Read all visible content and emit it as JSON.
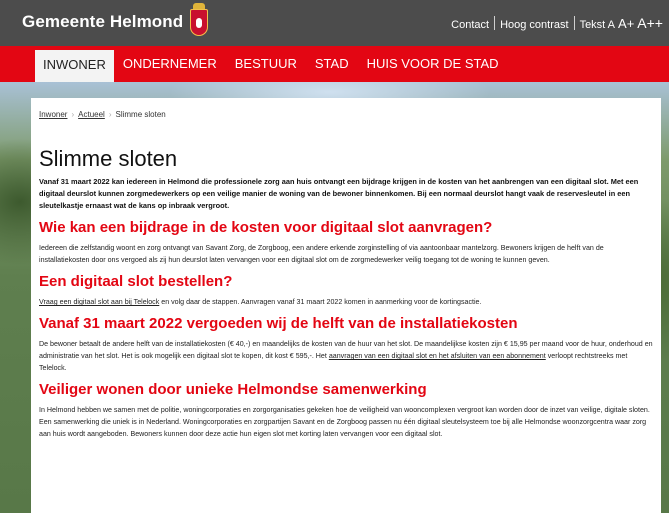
{
  "header": {
    "brand": "Gemeente Helmond",
    "contact": "Contact",
    "high_contrast": "Hoog contrast",
    "text_size_label": "Tekst A",
    "text_size_plus": "A+",
    "text_size_plusplus": "A++",
    "brand_color": "#4c4c4c"
  },
  "nav": {
    "color": "#e30613",
    "tabs": [
      "INWONER",
      "ONDERNEMER",
      "BESTUUR",
      "STAD",
      "HUIS VOOR DE STAD"
    ]
  },
  "breadcrumb": {
    "items": [
      "Inwoner",
      "Actueel"
    ],
    "current": "Slimme sloten"
  },
  "page": {
    "title": "Slimme sloten",
    "lead": "Vanaf 31 maart 2022 kan iedereen in Helmond die professionele zorg aan huis ontvangt een bijdrage krijgen in de kosten van het aanbrengen van een digitaal slot. Met een digitaal deurslot kunnen zorgmedewerkers op een veilige manier de woning van de bewoner binnenkomen. Bij een normaal deurslot hangt vaak de reservesleutel in een sleutelkastje ernaast wat de kans op inbraak vergroot.",
    "sections": [
      {
        "heading": "Wie kan een bijdrage in de kosten voor digitaal slot aanvragen?",
        "text": "Iedereen die zelfstandig woont en zorg ontvangt van Savant Zorg, de Zorgboog, een andere erkende zorginstelling of via aantoonbaar mantelzorg. Bewoners krijgen de helft van de installatiekosten door ons vergoed als zij hun deurslot laten vervangen voor een digitaal slot om de zorgmedewerker veilig toegang tot de woning te kunnen geven."
      },
      {
        "heading": "Een digitaal slot bestellen?",
        "link": "Vraag een digitaal slot aan bij Telelock",
        "text": " en volg daar de stappen. Aanvragen vanaf 31 maart 2022 komen in aanmerking voor de kortingsactie."
      },
      {
        "heading": "Vanaf 31 maart 2022 vergoeden wij de helft van de installatiekosten",
        "text": "De bewoner betaalt de andere helft van de installatiekosten (€ 40,-) en maandelijks de kosten van de huur van het slot. De maandelijkse kosten zijn € 15,95 per maand voor de huur, onderhoud en administratie van het slot. Het is ook mogelijk een digitaal slot te kopen, dit kost € 595,-. Het ",
        "link": "aanvragen van een digitaal slot en het afsluiten van een abonnement",
        "text_after": " verloopt rechtstreeks met Telelock."
      },
      {
        "heading": "Veiliger wonen door unieke Helmondse samenwerking",
        "text": "In Helmond hebben we samen met de politie, woningcorporaties en zorgorganisaties gekeken hoe de veiligheid van wooncomplexen vergroot kan worden door de inzet van veilige, digitale sloten. Een samenwerking die uniek is in Nederland. Woningcorporaties en zorgpartijen Savant en de Zorgboog passen nu één digitaal sleutelsysteem toe bij alle Helmondse woonzorgcentra waar zorg aan huis wordt aangeboden. Bewoners kunnen door deze actie hun eigen slot met korting laten vervangen voor een digitaal slot."
      }
    ]
  }
}
